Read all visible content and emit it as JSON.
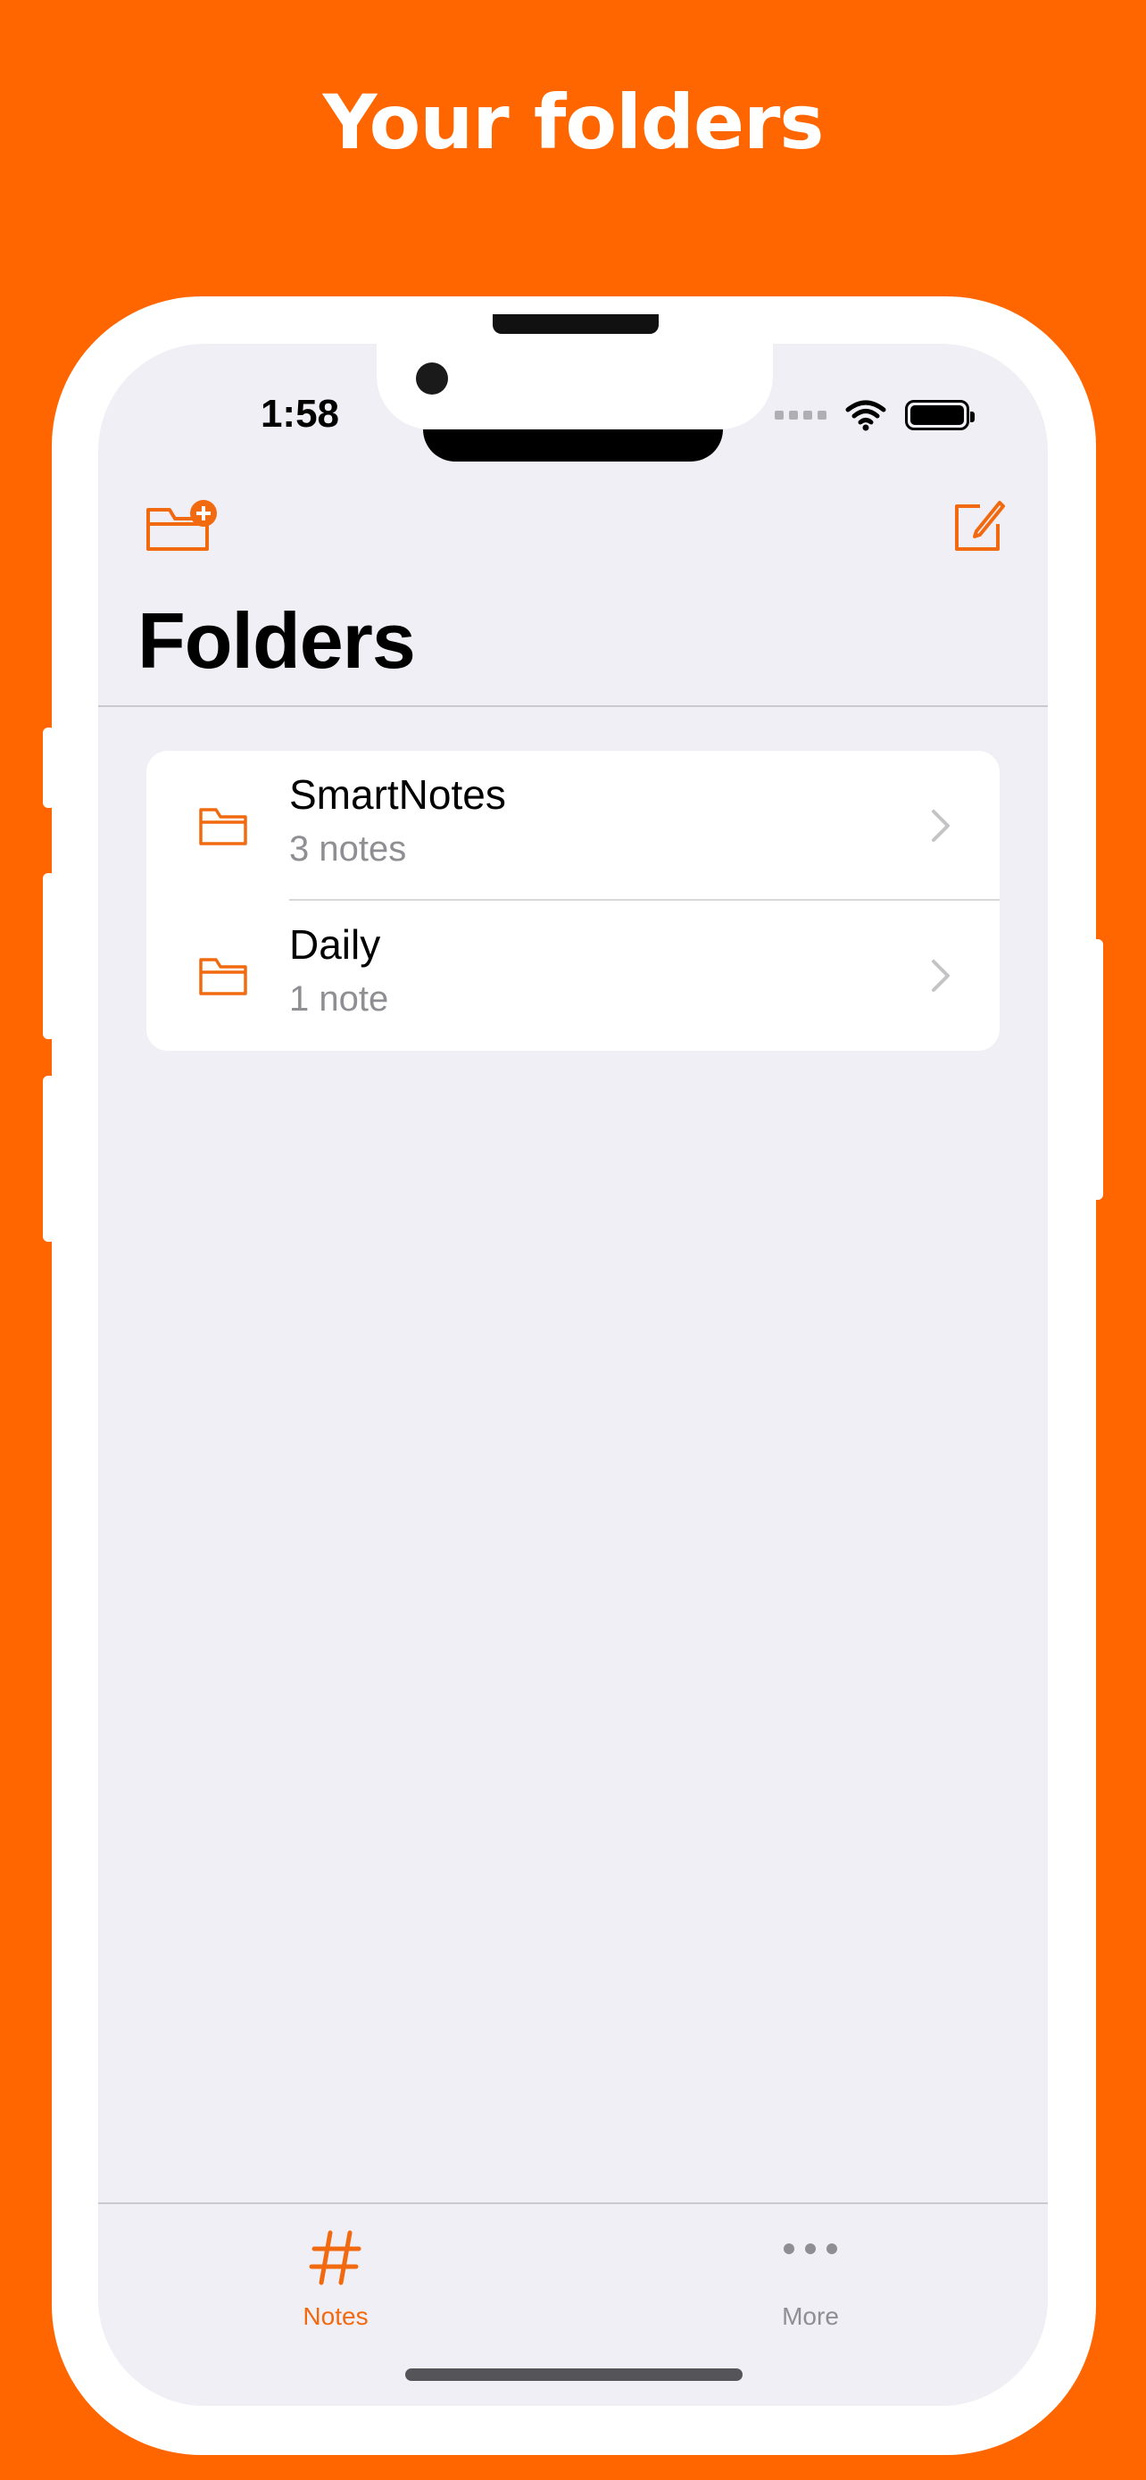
{
  "headline": "Your folders",
  "status_bar": {
    "time": "1:58"
  },
  "nav": {
    "title": "Folders"
  },
  "folders": [
    {
      "name": "SmartNotes",
      "count": "3 notes"
    },
    {
      "name": "Daily",
      "count": "1 note"
    }
  ],
  "tabs": {
    "notes": {
      "label": "Notes",
      "icon": "hashtag-icon"
    },
    "more": {
      "label": "More",
      "icon": "ellipsis-icon"
    }
  },
  "colors": {
    "accent": "#F26A10",
    "background": "#FF6600",
    "screen": "#F0EFF5",
    "secondary_text": "#8E8E93"
  }
}
